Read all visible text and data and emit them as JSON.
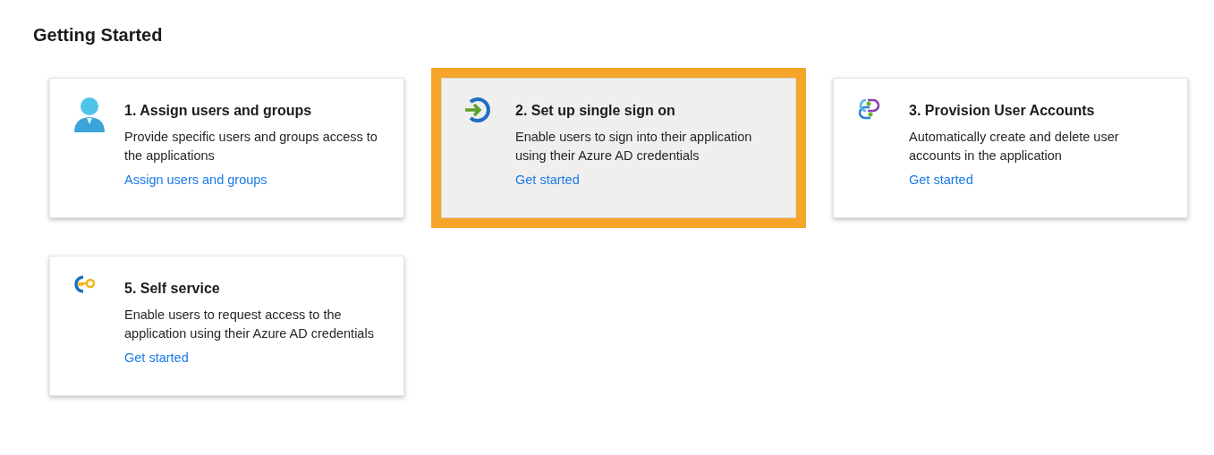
{
  "heading": "Getting Started",
  "cards": [
    {
      "title": "1. Assign users and groups",
      "description": "Provide specific users and groups access to the applications",
      "link": "Assign users and groups",
      "selected": false
    },
    {
      "title": "2. Set up single sign on",
      "description": "Enable users to sign into their application using their Azure AD credentials",
      "link": "Get started",
      "selected": true
    },
    {
      "title": "3. Provision User Accounts",
      "description": "Automatically create and delete user accounts in the application",
      "link": "Get started",
      "selected": false
    },
    {
      "title": "5. Self service",
      "description": "Enable users to request access to the application using their Azure AD credentials",
      "link": "Get started",
      "selected": false
    }
  ]
}
